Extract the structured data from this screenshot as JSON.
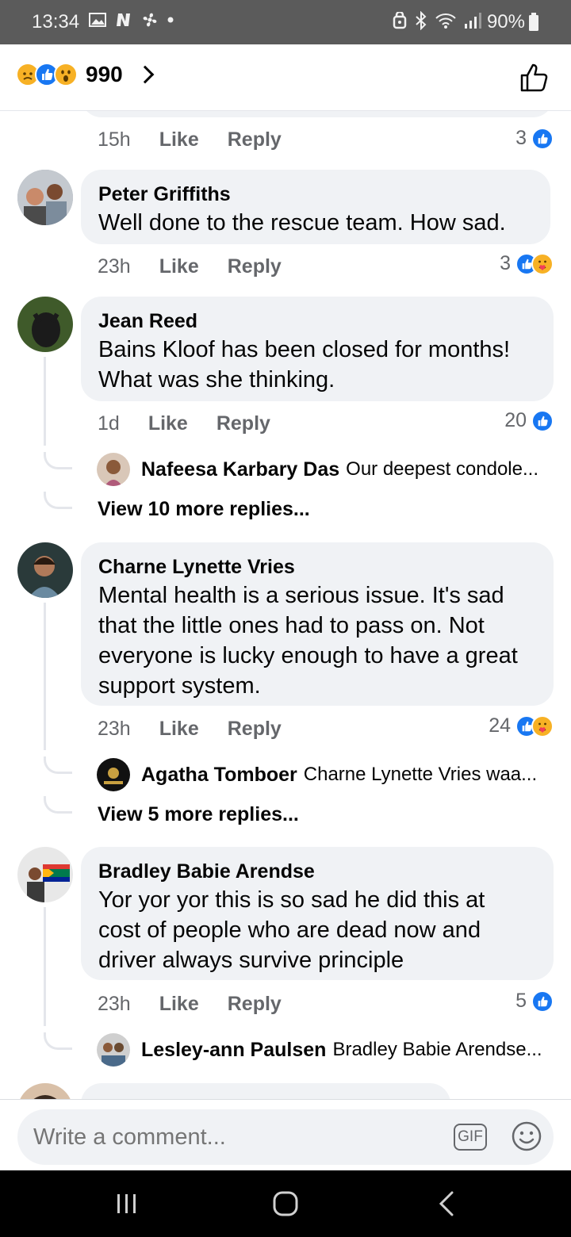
{
  "status_bar": {
    "time": "13:34",
    "left_icons": [
      "image-icon",
      "n-icon",
      "fan-icon",
      "dot-icon"
    ],
    "right_icons": [
      "alarm-icon",
      "bluetooth-icon",
      "wifi-icon",
      "signal-icon"
    ],
    "battery": "90%"
  },
  "header": {
    "reactions": [
      "sad",
      "like",
      "wow"
    ],
    "reaction_count": "990"
  },
  "comments": [
    {
      "author": "",
      "text": "",
      "time": "15h",
      "like_label": "Like",
      "reply_label": "Reply",
      "reaction_count": "3",
      "reactions": [
        "like"
      ]
    },
    {
      "author": "Peter Griffiths",
      "text": "Well done to the rescue team. How sad.",
      "time": "23h",
      "like_label": "Like",
      "reply_label": "Reply",
      "reaction_count": "3",
      "reactions": [
        "like",
        "care"
      ]
    },
    {
      "author": "Jean Reed",
      "text_lines": [
        "Bains Kloof has been closed for months!",
        "What was she thinking."
      ],
      "time": "1d",
      "like_label": "Like",
      "reply_label": "Reply",
      "reaction_count": "20",
      "reactions": [
        "like"
      ],
      "reply_preview": {
        "author": "Nafeesa Karbary Das",
        "text": "Our deepest condole..."
      },
      "view_more": "View 10 more replies..."
    },
    {
      "author": "Charne Lynette Vries",
      "text_lines": [
        "Mental health is a serious issue. It's sad",
        "that the little ones had to pass on. Not",
        "everyone is lucky enough to have a great",
        "support system."
      ],
      "time": "23h",
      "like_label": "Like",
      "reply_label": "Reply",
      "reaction_count": "24",
      "reactions": [
        "like",
        "care"
      ],
      "reply_preview": {
        "author": "Agatha Tomboer",
        "text": "Charne Lynette Vries waa..."
      },
      "view_more": "View 5 more replies..."
    },
    {
      "author": "Bradley Babie Arendse",
      "text_lines": [
        "Yor yor yor this is so sad he did this at",
        "cost of people who are dead now and",
        "driver always survive principle"
      ],
      "time": "23h",
      "like_label": "Like",
      "reply_label": "Reply",
      "reaction_count": "5",
      "reactions": [
        "like"
      ],
      "reply_preview": {
        "author": "Lesley-ann Paulsen",
        "text": "Bradley Babie Arendse..."
      }
    }
  ],
  "composer": {
    "placeholder": "Write a comment...",
    "gif_label": "GIF",
    "emoji_icon": "smiley-icon"
  },
  "nav_bar": {
    "buttons": [
      "recent-apps-icon",
      "home-icon",
      "back-icon"
    ]
  },
  "colors": {
    "like_blue": "#1877f2",
    "bubble_gray": "#f0f2f5",
    "meta_gray": "#65676b",
    "status_bar_gray": "#5b5b5b"
  }
}
